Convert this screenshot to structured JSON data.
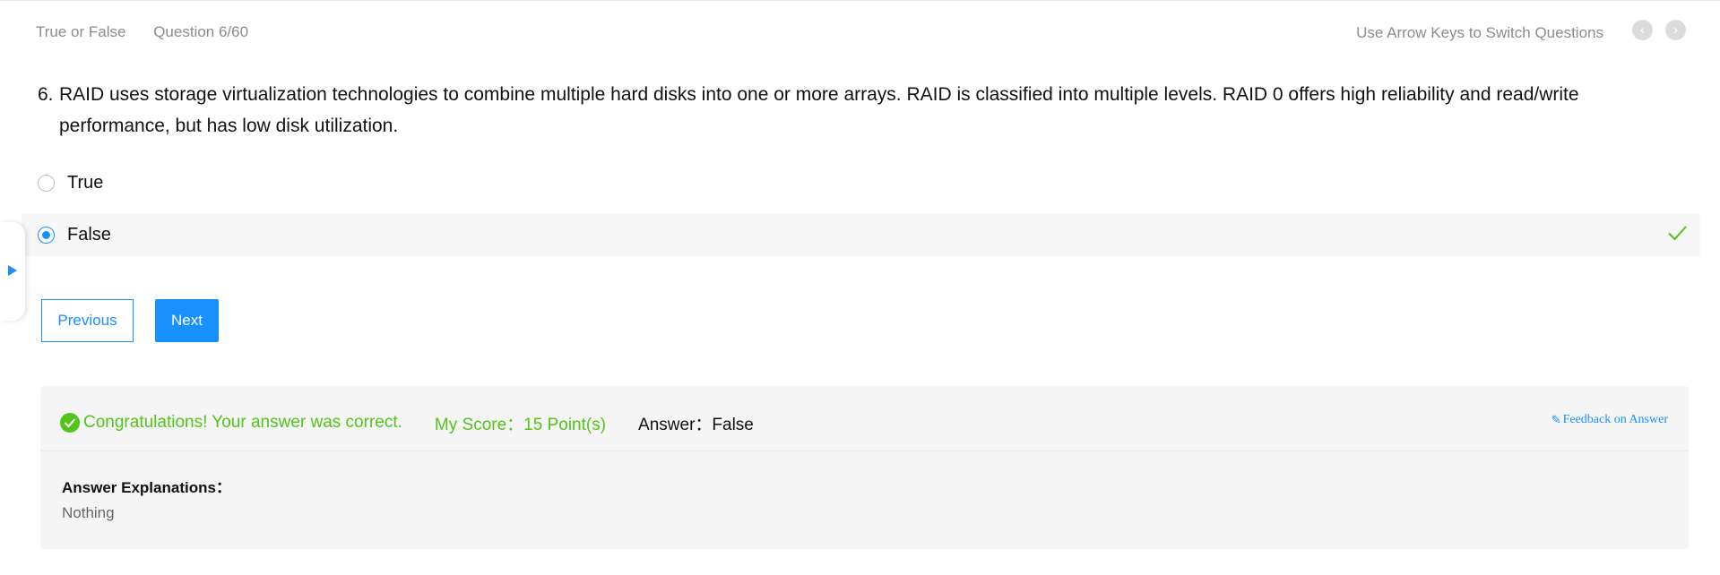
{
  "header": {
    "type_label": "True or False",
    "progress_label": "Question 6/60",
    "hint": "Use Arrow Keys to Switch Questions"
  },
  "icons": {
    "prev_arrow": "chevron-left-icon",
    "next_arrow": "chevron-right-icon",
    "correct": "checkmark-icon",
    "side_tab": "caret-right-icon",
    "feedback": "edit-icon"
  },
  "question": {
    "number": "6.",
    "text": "RAID uses storage virtualization technologies to combine multiple hard disks into one or more arrays. RAID is classified into multiple levels. RAID 0 offers high reliability and read/write performance, but has low disk utilization."
  },
  "options": [
    {
      "label": "True",
      "selected": false
    },
    {
      "label": "False",
      "selected": true
    }
  ],
  "buttons": {
    "previous": "Previous",
    "next": "Next"
  },
  "result": {
    "message": "Congratulations! Your answer was correct.",
    "score": "My Score：15 Point(s)",
    "answer": "Answer：False",
    "feedback_link": "Feedback on Answer",
    "explanation_title": "Answer Explanations：",
    "explanation_text": "Nothing"
  },
  "colors": {
    "accent": "#1890ff",
    "success": "#52c41a",
    "muted": "#8c8c8c",
    "panel_bg": "#f5f5f5"
  }
}
